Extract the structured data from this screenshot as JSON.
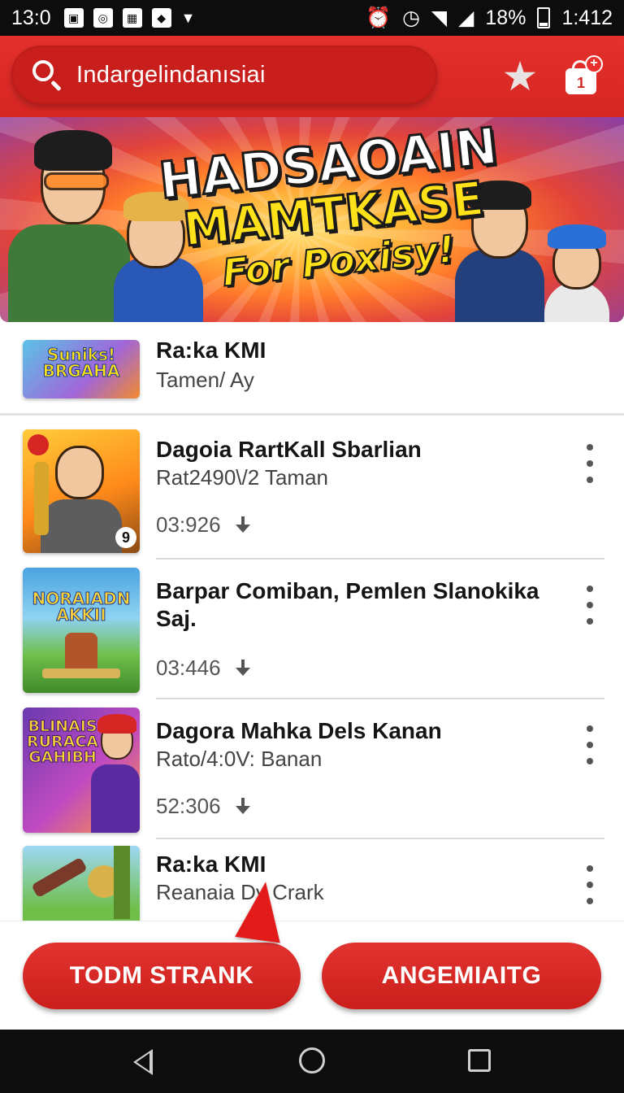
{
  "status_bar": {
    "time_left": "13:0",
    "battery": "18%",
    "time_right": "1:412"
  },
  "header": {
    "search_text": "Indargelindanısiai",
    "cart_count": "1"
  },
  "banner": {
    "line1": "HADSAOAIN",
    "line2": "MAMTKASE",
    "line3": "For Poxisy!"
  },
  "list": {
    "items": [
      {
        "title": "Ra:ka KMI",
        "subtitle": "Tamen/ Ay",
        "thumb_text": "Suniks! BRGAHA"
      },
      {
        "title": "Dagoia RartKall Sbarlian",
        "subtitle": "Rat2490\\/2 Taman",
        "meta": "03:926",
        "thumb_badge": "9"
      },
      {
        "title": "Barpar Comiban, Pemlen Slanokika Saj.",
        "meta": "03:446",
        "thumb_text": "NORAIADN AKKII"
      },
      {
        "title": "Dagora Mahka Dels Kanan",
        "subtitle": "Rato/4:0V: Banan",
        "meta": "52:306",
        "thumb_text": "BLINAIS RURACA GAHIBH"
      },
      {
        "title": "Ra:ka KMI",
        "subtitle": "Reanaia Dy Crark"
      }
    ]
  },
  "buttons": {
    "left": "TODM STRANK",
    "right": "ANGEMIAITG"
  },
  "colors": {
    "accent": "#d62623",
    "status_bar": "#0d0d0d"
  }
}
